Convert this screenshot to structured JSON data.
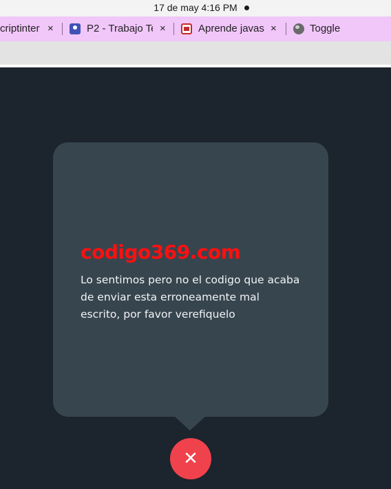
{
  "os": {
    "clock": "17 de may   4:16 PM"
  },
  "tabs": [
    {
      "title": "criptinter",
      "favicon": "",
      "close": "×"
    },
    {
      "title": "P2 - Trabajo Te",
      "favicon": "profile-card-icon",
      "close": "×"
    },
    {
      "title": "Aprende javas",
      "favicon": "code-site-icon",
      "close": "×"
    },
    {
      "title": "Toggle",
      "favicon": "globe-icon",
      "close": ""
    }
  ],
  "popup": {
    "title": "codigo369.com",
    "message": "Lo sentimos pero no el codigo que acaba de enviar esta erroneamente mal escrito, por favor verefiquelo",
    "close_symbol": "✕"
  },
  "colors": {
    "background": "#1c242d",
    "popup_bg": "#37454f",
    "title": "#ff1010",
    "close_button": "#f0424c",
    "tab_strip": "#f1c6f9"
  }
}
